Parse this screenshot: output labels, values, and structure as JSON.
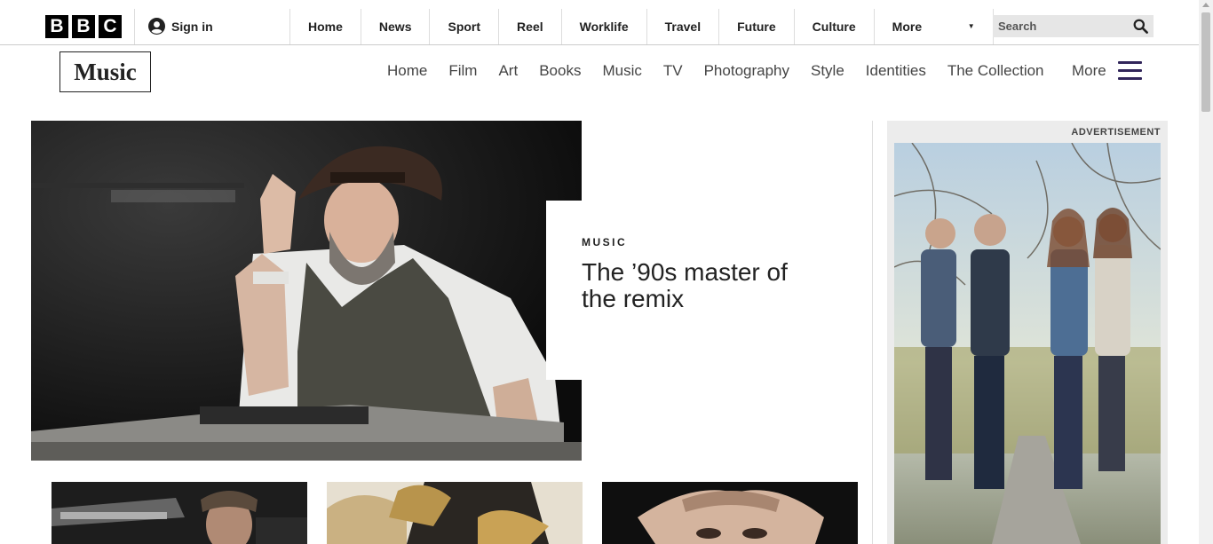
{
  "global_nav": {
    "logo_letters": [
      "B",
      "B",
      "C"
    ],
    "signin_label": "Sign in",
    "items": [
      {
        "label": "Home"
      },
      {
        "label": "News"
      },
      {
        "label": "Sport"
      },
      {
        "label": "Reel"
      },
      {
        "label": "Worklife"
      },
      {
        "label": "Travel"
      },
      {
        "label": "Future"
      },
      {
        "label": "Culture"
      }
    ],
    "more_label": "More",
    "search_placeholder": "Search"
  },
  "section": {
    "logo": "Music",
    "nav": [
      {
        "label": "Home"
      },
      {
        "label": "Film"
      },
      {
        "label": "Art"
      },
      {
        "label": "Books"
      },
      {
        "label": "Music"
      },
      {
        "label": "TV"
      },
      {
        "label": "Photography"
      },
      {
        "label": "Style"
      },
      {
        "label": "Identities"
      },
      {
        "label": "The Collection"
      }
    ],
    "more_label": "More",
    "accent_color": "#31255a"
  },
  "hero": {
    "kicker": "Music",
    "title": "The ’90s master of the remix"
  },
  "advertisement": {
    "label": "ADVERTISEMENT"
  },
  "cards": [
    {
      "image": "man-with-gun-photo"
    },
    {
      "image": "woman-with-trophies-photo"
    },
    {
      "image": "man-hands-on-head-photo"
    }
  ]
}
